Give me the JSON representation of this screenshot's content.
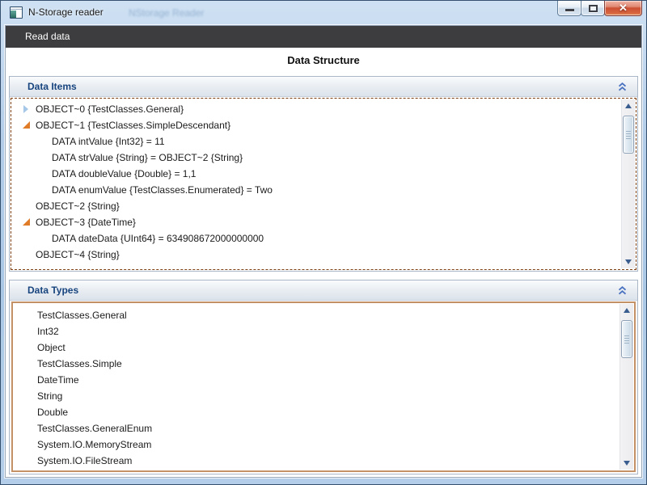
{
  "window": {
    "title": "N-Storage reader",
    "ghost_title": "NStorage Reader"
  },
  "menubar": {
    "items": [
      {
        "label": "Read data"
      }
    ]
  },
  "main": {
    "title": "Data Structure"
  },
  "data_items": {
    "header": "Data Items",
    "rows": [
      {
        "text": "OBJECT~0 {TestClasses.General}",
        "indent": 0,
        "expander": "collapsed"
      },
      {
        "text": "OBJECT~1 {TestClasses.SimpleDescendant}",
        "indent": 0,
        "expander": "expanded"
      },
      {
        "text": "DATA intValue {Int32} = 11",
        "indent": 1,
        "expander": "none"
      },
      {
        "text": "DATA strValue {String} = OBJECT~2 {String}",
        "indent": 1,
        "expander": "none"
      },
      {
        "text": "DATA doubleValue {Double} = 1,1",
        "indent": 1,
        "expander": "none"
      },
      {
        "text": "DATA enumValue {TestClasses.Enumerated} = Two",
        "indent": 1,
        "expander": "none"
      },
      {
        "text": "OBJECT~2 {String}",
        "indent": 0,
        "expander": "none"
      },
      {
        "text": "OBJECT~3 {DateTime}",
        "indent": 0,
        "expander": "expanded"
      },
      {
        "text": "DATA dateData {UInt64} = 634908672000000000",
        "indent": 1,
        "expander": "none"
      },
      {
        "text": "OBJECT~4 {String}",
        "indent": 0,
        "expander": "none"
      }
    ]
  },
  "data_types": {
    "header": "Data Types",
    "items": [
      {
        "text": "TestClasses.General"
      },
      {
        "text": "Int32"
      },
      {
        "text": "Object"
      },
      {
        "text": "TestClasses.Simple"
      },
      {
        "text": "DateTime"
      },
      {
        "text": "String"
      },
      {
        "text": "Double"
      },
      {
        "text": "TestClasses.GeneralEnum"
      },
      {
        "text": "System.IO.MemoryStream"
      },
      {
        "text": "System.IO.FileStream"
      }
    ]
  },
  "icons": {
    "collapse_button": "chevron-double-up",
    "tree_collapsed": "triangle-right",
    "tree_expanded": "triangle-lower-right"
  },
  "colors": {
    "frame_blue": "#AEC9E6",
    "menubar_bg": "#3D3D3F",
    "section_header_text": "#17447E",
    "expander_collapsed": "#A6C8E8",
    "expander_expanded": "#E07B28",
    "items_focus_border_dashed": "#7E3F12",
    "types_border_solid": "#C49066",
    "close_button_red": "#CC4F33",
    "chevron_blue": "#4A72C0",
    "scroll_arrow_navy": "#3A5D8F"
  }
}
